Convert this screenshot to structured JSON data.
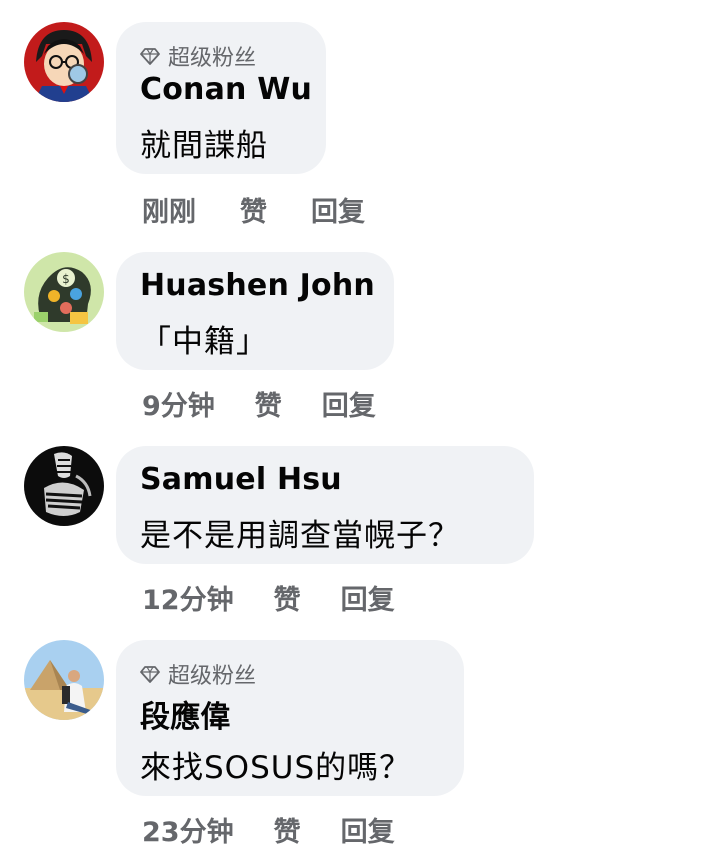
{
  "comments": [
    {
      "badge": "超级粉丝",
      "author": "Conan Wu",
      "text": "就間諜船",
      "time": "刚刚",
      "like": "赞",
      "reply": "回复",
      "avatar_icon": "anime-detective-avatar"
    },
    {
      "author": "Huashen John",
      "text": "「中籍」",
      "time": "9分钟",
      "like": "赞",
      "reply": "回复",
      "avatar_icon": "money-head-illustration-avatar"
    },
    {
      "author": "Samuel Hsu",
      "text": "是不是用調查當幌子？",
      "time": "12分钟",
      "like": "赞",
      "reply": "回复",
      "avatar_icon": "black-white-abstract-avatar"
    },
    {
      "badge": "超级粉丝",
      "author": "段應偉",
      "text": "來找SOSUS的嗎？",
      "time": "23分钟",
      "like": "赞",
      "reply": "回复",
      "avatar_icon": "pyramid-photo-avatar"
    }
  ],
  "colors": {
    "bubble": "#f0f2f5",
    "author": "#050505",
    "meta": "#65676b"
  }
}
